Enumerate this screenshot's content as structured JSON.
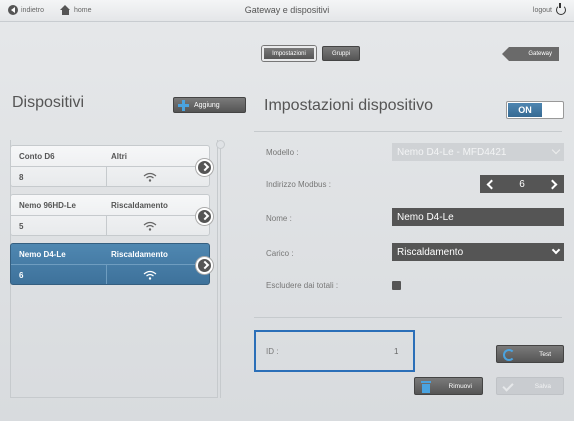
{
  "topbar": {
    "back_label": "indietro",
    "home_label": "home",
    "title": "Gateway e dispositivi",
    "logout_label": "logout"
  },
  "left": {
    "title": "Dispositivi",
    "add_label": "Aggiung",
    "devices": [
      {
        "name": "Conto D6",
        "category": "Altri",
        "address": "8",
        "selected": false
      },
      {
        "name": "Nemo 96HD-Le",
        "category": "Riscaldamento",
        "address": "5",
        "selected": false
      },
      {
        "name": "Nemo D4-Le",
        "category": "Riscaldamento",
        "address": "6",
        "selected": true
      }
    ]
  },
  "tabs": [
    {
      "label": "Impostazioni",
      "active": true
    },
    {
      "label": "Gruppi",
      "active": false
    }
  ],
  "gateway_label": "Gateway",
  "panel": {
    "title": "Impostazioni dispositivo",
    "toggle_label": "ON",
    "fields": {
      "model_label": "Modello :",
      "model_value": "Nemo D4-Le - MFD4421",
      "modbus_label": "Indirizzo Modbus :",
      "modbus_value": "6",
      "name_label": "Nome :",
      "name_value": "Nemo D4-Le",
      "load_label": "Carico :",
      "load_value": "Riscaldamento",
      "exclude_label": "Escludere dai totali :"
    },
    "id_label": "ID :",
    "id_value": "1",
    "test_label": "Test",
    "remove_label": "Rimuovi",
    "save_label": "Salva"
  },
  "colors": {
    "accent": "#4a82ad",
    "highlight_border": "#2b6fb8",
    "icon_blue": "#4aa3e0"
  }
}
